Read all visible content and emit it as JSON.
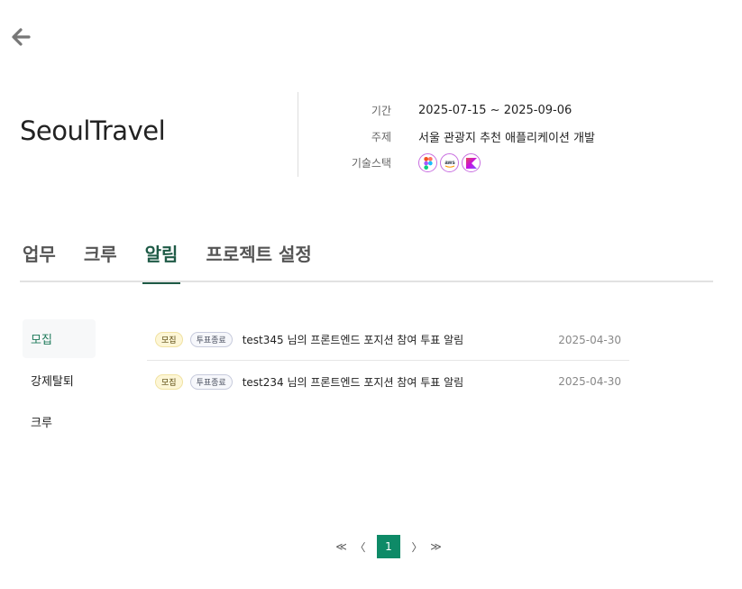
{
  "project": {
    "title": "SeoulTravel",
    "period_label": "기간",
    "period_value": "2025-07-15 ~ 2025-09-06",
    "topic_label": "주제",
    "topic_value": "서울 관광지 추천 애플리케이션 개발",
    "stack_label": "기술스택",
    "stack_icons": [
      "figma-icon",
      "aws-icon",
      "kotlin-icon"
    ]
  },
  "tabs": [
    {
      "label": "업무"
    },
    {
      "label": "크루"
    },
    {
      "label": "알림",
      "active": true
    },
    {
      "label": "프로젝트 설정"
    }
  ],
  "sidebar": {
    "items": [
      {
        "label": "모집",
        "active": true
      },
      {
        "label": "강제탈퇴"
      },
      {
        "label": "크루"
      }
    ]
  },
  "notifications": [
    {
      "type_badge": "모집",
      "status_badge": "투표종료",
      "text": "test345 님의 프론트엔드 포지션 참여 투표 알림",
      "date": "2025-04-30"
    },
    {
      "type_badge": "모집",
      "status_badge": "투표종료",
      "text": "test234 님의 프론트엔드 포지션 참여 투표 알림",
      "date": "2025-04-30"
    }
  ],
  "pagination": {
    "first": "≪",
    "prev": "〈",
    "current": "1",
    "next": "〉",
    "last": "≫"
  },
  "colors": {
    "accent": "#0e8a67",
    "tab_active": "#1e5a46",
    "recruit_badge_bg": "#fdf6d6",
    "vote_badge_border": "#c7cbdc"
  }
}
